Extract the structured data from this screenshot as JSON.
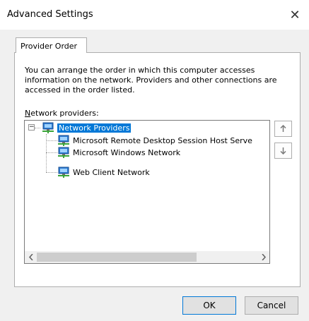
{
  "window": {
    "title": "Advanced Settings",
    "close_glyph": "✕"
  },
  "tabs": [
    {
      "label": "Provider Order",
      "selected": true
    }
  ],
  "description": "You can arrange the order in which this computer accesses information on the network.  Providers and other connections are accessed in the order listed.",
  "providers_label": {
    "mnemonic": "N",
    "rest": "etwork providers:"
  },
  "tree": {
    "root": {
      "label": "Network Providers",
      "expanded": true,
      "selected": true,
      "icon": "network-icon"
    },
    "children": [
      {
        "label": "Microsoft Remote Desktop Session Host Serve",
        "icon": "network-icon"
      },
      {
        "label": "Microsoft Windows Network",
        "icon": "network-icon"
      },
      {
        "label": "Web Client Network",
        "icon": "network-icon"
      }
    ]
  },
  "move_up_icon": "arrow-up-icon",
  "move_down_icon": "arrow-down-icon",
  "buttons": {
    "ok": "OK",
    "cancel": "Cancel"
  },
  "colors": {
    "selection": "#0078d7",
    "dialog_bg": "#f0f0f0"
  }
}
